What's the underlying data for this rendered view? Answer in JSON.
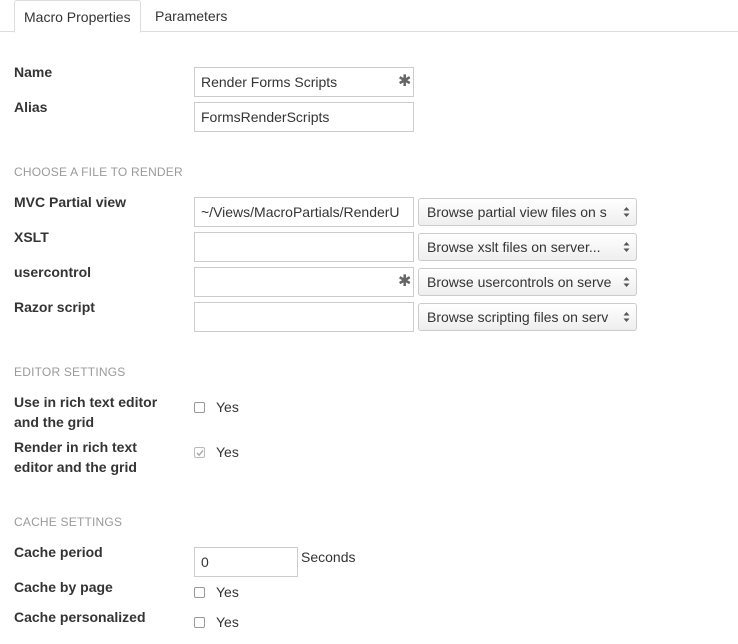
{
  "tabs": [
    {
      "label": "Macro Properties",
      "active": true
    },
    {
      "label": "Parameters",
      "active": false
    }
  ],
  "name": {
    "label": "Name",
    "value": "Render Forms Scripts",
    "required": true
  },
  "alias": {
    "label": "Alias",
    "value": "FormsRenderScripts"
  },
  "file_section": {
    "title": "CHOOSE A FILE TO RENDER",
    "mvc": {
      "label": "MVC Partial view",
      "value": "~/Views/MacroPartials/RenderU",
      "select": "Browse partial view files on s"
    },
    "xslt": {
      "label": "XSLT",
      "value": "",
      "select": "Browse xslt files on server..."
    },
    "usercontrol": {
      "label": "usercontrol",
      "value": "",
      "required": true,
      "select": "Browse usercontrols on serve"
    },
    "razor": {
      "label": "Razor script",
      "value": "",
      "select": "Browse scripting files on serv"
    }
  },
  "editor_section": {
    "title": "EDITOR SETTINGS",
    "use_rte": {
      "label_line1": "Use in rich text editor",
      "label_line2": "and the grid",
      "option": "Yes",
      "checked": false
    },
    "render_rte": {
      "label_line1": "Render in rich text",
      "label_line2": "editor and the grid",
      "option": "Yes",
      "checked": true
    }
  },
  "cache_section": {
    "title": "CACHE SETTINGS",
    "period": {
      "label": "Cache period",
      "value": "0",
      "units": "Seconds"
    },
    "by_page": {
      "label": "Cache by page",
      "option": "Yes",
      "checked": false
    },
    "personalized": {
      "label": "Cache personalized",
      "option": "Yes",
      "checked": false
    }
  },
  "colors": {
    "border": "#cccccc",
    "section": "#9a9a9a",
    "text": "#343434"
  }
}
